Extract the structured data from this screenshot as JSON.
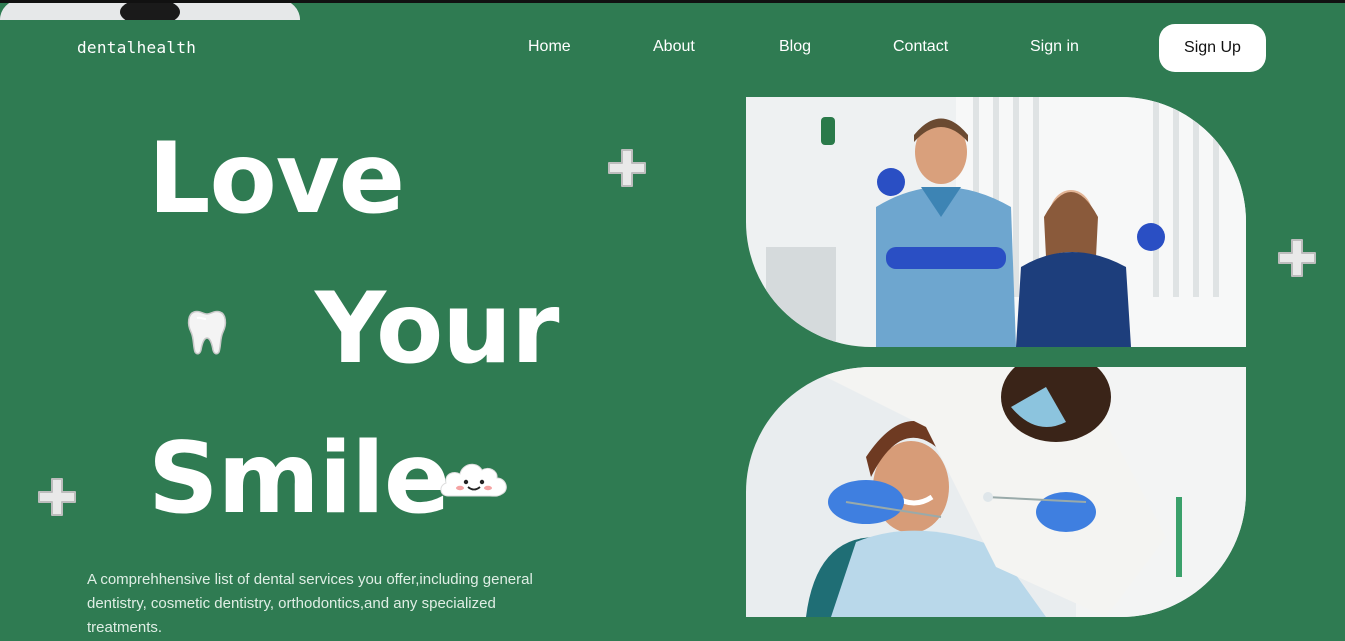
{
  "brand": {
    "logo": "dentalhealth"
  },
  "nav": {
    "items": [
      "Home",
      "About",
      "Blog",
      "Contact",
      "Sign in"
    ],
    "signup_label": "Sign Up"
  },
  "hero": {
    "line1": "Love",
    "line2": "Your",
    "line3": "Smile",
    "description": "A comprehhensive list of dental services you offer,including general dentistry, cosmetic dentistry, orthodontics,and any specialized treatments."
  },
  "colors": {
    "background": "#2f7b52",
    "text": "#ffffff",
    "button_bg": "#ffffff"
  },
  "icons": [
    "plus-icon",
    "tooth-icon",
    "cloud-smile-icon"
  ]
}
